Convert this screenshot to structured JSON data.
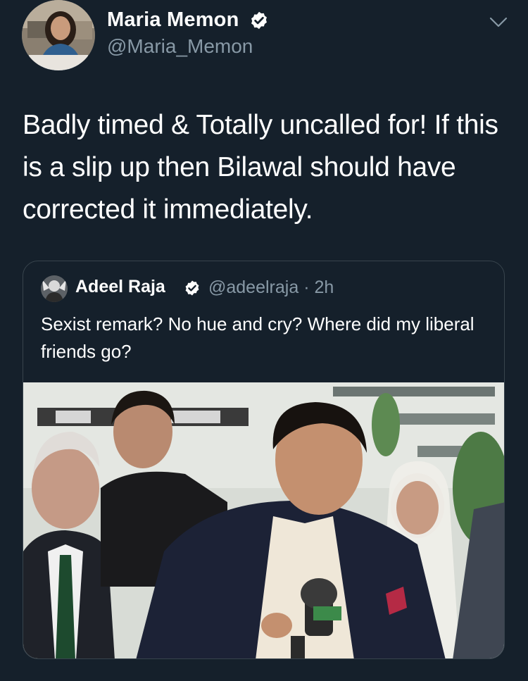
{
  "tweet": {
    "author": {
      "name": "Maria Memon",
      "handle": "@Maria_Memon",
      "verified": true
    },
    "text": "Badly timed & Totally uncalled for! If this is a slip up then Bilawal should have corrected it immediately.",
    "menu_icon": "chevron-down-icon"
  },
  "quoted_tweet": {
    "author": {
      "name": "Adeel Raja",
      "handle": "@adeelraja",
      "verified": true
    },
    "time": "· 2h",
    "text": "Sexist remark? No hue and cry? Where did my liberal friends go?",
    "media": "press-conference-photo"
  },
  "colors": {
    "background": "#15202b",
    "secondary_text": "#8899a6",
    "border": "#38444d",
    "verified_badge": "#ffffff"
  }
}
